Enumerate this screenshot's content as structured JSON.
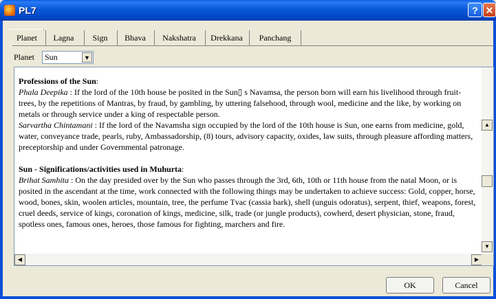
{
  "window": {
    "title": "PL7",
    "help_label": "?",
    "close_label": "✕"
  },
  "tabs": [
    {
      "label": "Planet"
    },
    {
      "label": "Lagna"
    },
    {
      "label": "Sign"
    },
    {
      "label": "Bhava"
    },
    {
      "label": "Nakshatra"
    },
    {
      "label": "Drekkana"
    },
    {
      "label": "Panchang"
    }
  ],
  "planet_selector": {
    "label": "Planet",
    "value": "Sun"
  },
  "content": {
    "h1": "Professions of the Sun",
    "h1_colon": ":",
    "p1_src": "Phala Deepika",
    "p1_text": " : If the lord of the 10th house be posited in the Sun▯ s Navamsa, the person born will earn his livelihood through fruit-trees, by the repetitions of Mantras, by fraud, by gambling, by uttering falsehood, through wool, medicine and the like, by working on metals or through service under a king of respectable person.",
    "p2_src": "Sarvartha Chintamani",
    "p2_text": " : If the lord of the Navamsha sign occupied by the lord of the 10th house is Sun, one earns from medicine, gold, water, conveyance trade, pearls, ruby, Ambassadorship, (8) tours, advisory capacity, oxides, law suits, through pleasure affording matters, preceptorship and under Governmental patronage.",
    "h2": "Sun - Significations/activities used in Muhurta",
    "h2_colon": ":",
    "p3_src": "Brihat Samhita",
    "p3_text": " : On the day presided over by the Sun who passes through the 3rd, 6th, 10th or 11th house from the natal Moon, or is posited in the ascendant at the time, work connected with the following things may be undertaken to achieve success: Gold, copper, horse, wood, bones, skin, woolen articles, mountain, tree, the perfume Tvac (cassia bark), shell (unguis odoratus), serpent, thief, weapons, forest, cruel deeds, service of kings, coronation of kings, medicine, silk, trade (or jungle products), cowherd, desert physician, stone, fraud, spotless ones, famous ones, heroes, those famous for fighting, marchers and fire."
  },
  "buttons": {
    "ok": "OK",
    "cancel": "Cancel"
  },
  "scroll_glyphs": {
    "up": "▲",
    "down": "▼",
    "left": "◀",
    "right": "▶",
    "select": "▼"
  }
}
